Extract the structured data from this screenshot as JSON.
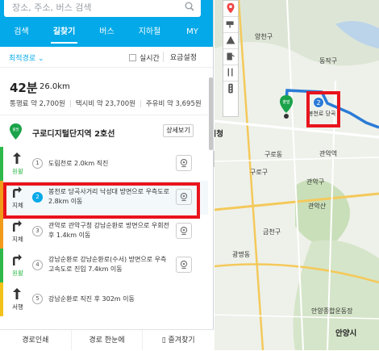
{
  "search": {
    "placeholder": "장소, 주소, 버스 검색"
  },
  "tabs": [
    {
      "label": "검색"
    },
    {
      "label": "길찾기"
    },
    {
      "label": "버스"
    },
    {
      "label": "지하철"
    },
    {
      "label": "MY"
    }
  ],
  "options": {
    "sort": "최적경로",
    "realtime": "실시간",
    "fare_setting": "요금설정"
  },
  "summary": {
    "time": "42분",
    "distance": "26.0km",
    "toll": "통행료 약 2,700원",
    "taxi": "택시비 약 23,700원",
    "fuel": "주유비 약 3,695원"
  },
  "start": {
    "badge": "출발",
    "name": "구로디지털단지역 2호선",
    "detail_button": "상세보기"
  },
  "steps": [
    {
      "num": "1",
      "direction": "원활",
      "text": "도림천로 2.0km 직진",
      "color": "#2fb84a",
      "arrow": "straight"
    },
    {
      "num": "2",
      "direction": "지체",
      "text": "봉천로 당곡사거리 낙성대 방면으로 우측도로 2.8km 이동",
      "color": "#f29b1b",
      "arrow": "right"
    },
    {
      "num": "3",
      "direction": "지체",
      "text": "관악로 관악구청 강남순환로 방면으로 우회전 후 1.4km 이동",
      "color": "#f29b1b",
      "arrow": "right"
    },
    {
      "num": "4",
      "direction": "원활",
      "text": "강남순환로 강남순환로(수서) 방면으로 우측 고속도로 진입 7.4km 이동",
      "color": "#2fb84a",
      "arrow": "right"
    },
    {
      "num": "5",
      "direction": "서행",
      "text": "강남순환로 직진 후 302m 이동",
      "color": "#f2c21b",
      "arrow": "straight"
    }
  ],
  "bottom": {
    "print": "경로인쇄",
    "overview": "경로 한눈에",
    "favorite": "즐겨찾기"
  },
  "map": {
    "labels": [
      "광명시청",
      "구로구",
      "관악구",
      "금천구",
      "양천구",
      "동작구",
      "안양시",
      "광명동",
      "구로동",
      "관악산",
      "안양종합운동장",
      "관악역"
    ],
    "start_marker": "출발",
    "step_marker": "2",
    "step_marker_label": "봉천로 당곡",
    "route_color": "#2b7bd6"
  },
  "colors": {
    "accent": "#03a9e8",
    "highlight_box": "#e8141d"
  }
}
